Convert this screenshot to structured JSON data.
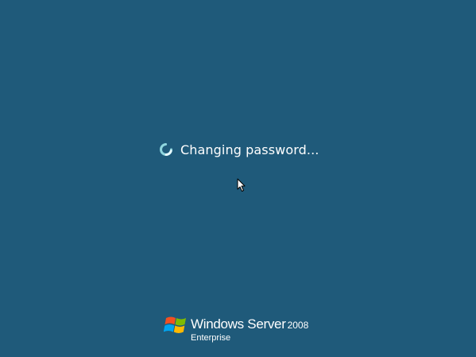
{
  "status": {
    "icon": "loading-spinner-icon",
    "message": "Changing password..."
  },
  "cursor": {
    "icon": "mouse-pointer-icon"
  },
  "branding": {
    "logo_icon": "windows-flag-icon",
    "product_name": "Windows Server",
    "version": "2008",
    "edition": "Enterprise"
  },
  "colors": {
    "background": "#1f5a7a",
    "text": "#ffffff",
    "spinner_accent": "#7fe0e8"
  }
}
